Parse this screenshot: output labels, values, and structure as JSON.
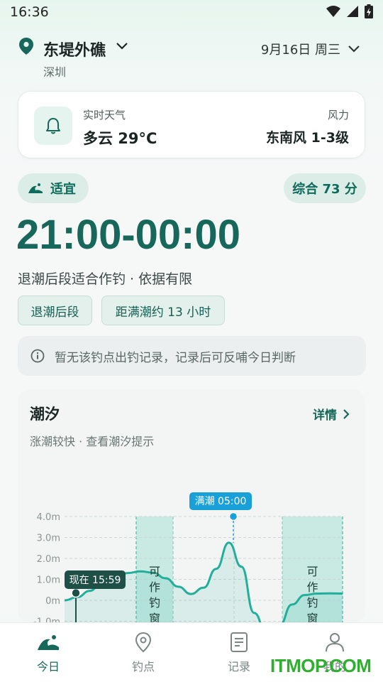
{
  "status_bar": {
    "time": "16:36",
    "icons": [
      "wifi-icon",
      "signal-icon",
      "battery-charging-icon"
    ]
  },
  "location": {
    "name": "东堤外礁",
    "city": "深圳",
    "date": "9月16日 周三"
  },
  "weather": {
    "label": "实时天气",
    "value": "多云  29°C",
    "wind_label": "风力",
    "wind_value": "东南风 1-3级",
    "icon": "bell-icon"
  },
  "status": {
    "suitability": "适宜",
    "score": "综合 73 分"
  },
  "window": {
    "time": "21:00-00:00",
    "description": "退潮后段适合作钓 · 依据有限"
  },
  "tags": [
    "退潮后段",
    "距满潮约 13 小时"
  ],
  "notice": {
    "icon": "info-icon",
    "text": "暂无该钓点出钓记录，记录后可反哺今日判断"
  },
  "tide": {
    "title": "潮汐",
    "detail_label": "详情",
    "subtitle": "涨潮较快 · 查看潮汐提示",
    "now_label": "现在 15:59",
    "high_label": "满潮 05:00",
    "window_label": "可作钓窗"
  },
  "chart_data": {
    "type": "area",
    "title": "",
    "xlabel": "",
    "ylabel": "",
    "y_ticks": [
      "4.0m",
      "3.0m",
      "2.0m",
      "1.0m",
      "0m",
      "-1.0m"
    ],
    "ylim": [
      -1.0,
      4.0
    ],
    "grid": true,
    "series": [
      {
        "points_m": [
          0.0,
          0.15,
          0.45,
          0.9,
          1.2,
          1.3,
          1.38,
          1.32,
          1.05,
          0.65,
          0.3,
          0.6,
          1.5,
          2.75,
          1.6,
          -0.6,
          -1.6,
          -1.2,
          -0.2,
          0.25,
          0.32,
          0.33,
          0.32
        ]
      }
    ],
    "highlight_bands": 2,
    "current_value_m": 0.35,
    "high_tide_value_m": 4.0,
    "colors": {
      "line": "#22ae9a",
      "band": "#bfe8df",
      "accent": "#17685a",
      "marker": "#1aa0d8"
    }
  },
  "nav": {
    "items": [
      "今日",
      "钓点",
      "记录",
      "我的"
    ],
    "active": "今日"
  },
  "watermark": "ITMOP.COM",
  "colors": {
    "primary": "#17685a",
    "pill_bg": "#dcece7"
  }
}
